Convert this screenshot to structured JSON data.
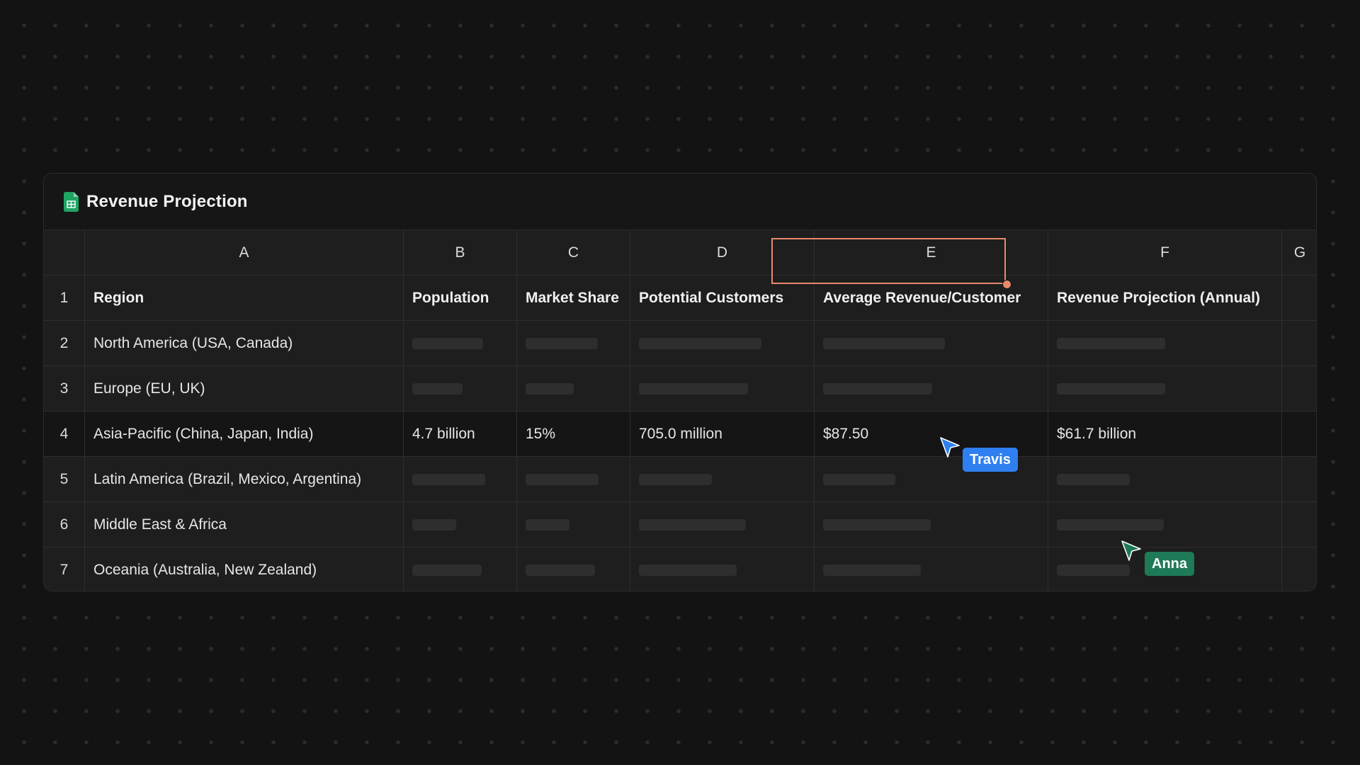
{
  "document": {
    "title": "Revenue Projection"
  },
  "columns": [
    "A",
    "B",
    "C",
    "D",
    "E",
    "F",
    "G"
  ],
  "rows": [
    {
      "number": "1",
      "cells": [
        "Region",
        "Population",
        "Market Share",
        "Potential Customers",
        "Average Revenue/Customer",
        "Revenue Projection (Annual)",
        ""
      ]
    },
    {
      "number": "2",
      "cells": [
        "North America (USA, Canada)",
        "",
        "",
        "",
        "",
        "",
        ""
      ]
    },
    {
      "number": "3",
      "cells": [
        "Europe (EU, UK)",
        "",
        "",
        "",
        "",
        "",
        ""
      ]
    },
    {
      "number": "4",
      "cells": [
        "Asia-Pacific (China, Japan, India)",
        "4.7 billion",
        "15%",
        "705.0 million",
        "$87.50",
        "$61.7 billion",
        ""
      ]
    },
    {
      "number": "5",
      "cells": [
        "Latin America (Brazil, Mexico, Argentina)",
        "",
        "",
        "",
        "",
        "",
        ""
      ]
    },
    {
      "number": "6",
      "cells": [
        "Middle East & Africa",
        "",
        "",
        "",
        "",
        "",
        ""
      ]
    },
    {
      "number": "7",
      "cells": [
        "Oceania (Australia, New Zealand)",
        "",
        "",
        "",
        "",
        "",
        ""
      ]
    }
  ],
  "selection": {
    "cell": "E4",
    "color": "#e8896b"
  },
  "collaborators": [
    {
      "name": "Travis",
      "color": "#2f7ff0"
    },
    {
      "name": "Anna",
      "color": "#1f7a57"
    }
  ],
  "icons": {
    "document": "spreadsheet-icon",
    "cursor": "pointer-cursor-icon"
  },
  "colors": {
    "background": "#131313",
    "cell": "#1e1e1e",
    "active_row": "#151515",
    "sheets_green": "#1fa463"
  }
}
